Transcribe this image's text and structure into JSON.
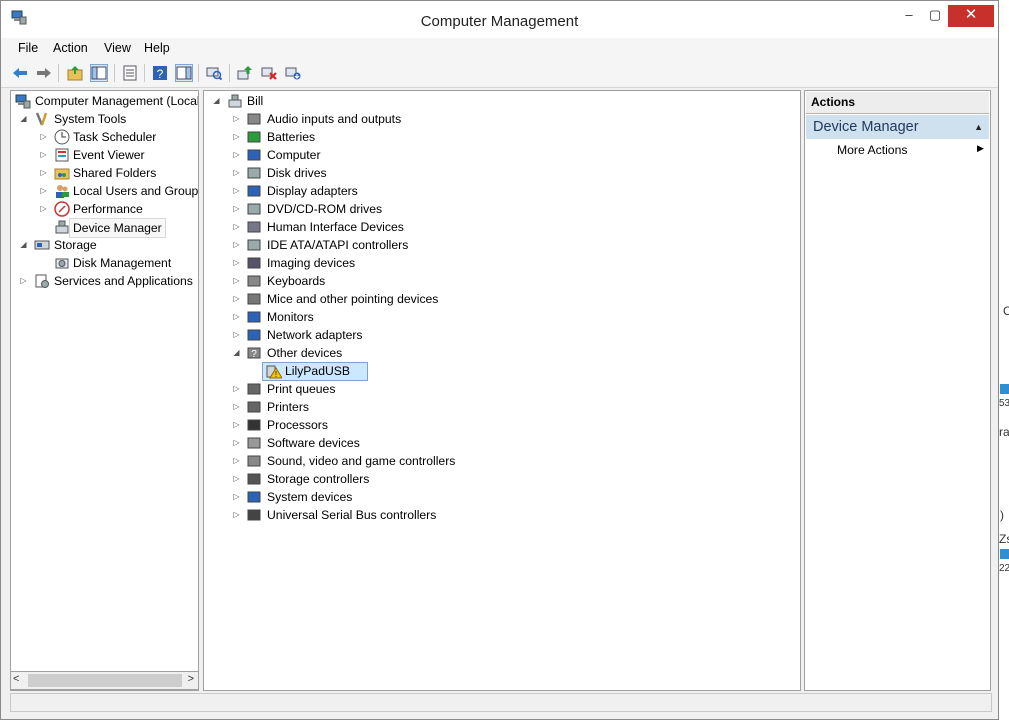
{
  "window": {
    "title": "Computer Management",
    "controls": {
      "minimize": "–",
      "maximize": "▢",
      "close": "✕"
    }
  },
  "menu": [
    "File",
    "Action",
    "View",
    "Help"
  ],
  "left_tree": {
    "root": "Computer Management (Local",
    "system_tools": {
      "label": "System Tools",
      "children": [
        "Task Scheduler",
        "Event Viewer",
        "Shared Folders",
        "Local Users and Groups",
        "Performance",
        "Device Manager"
      ]
    },
    "storage": {
      "label": "Storage",
      "children": [
        "Disk Management"
      ]
    },
    "services": "Services and Applications"
  },
  "device_tree": {
    "root": "Bill",
    "categories": [
      "Audio inputs and outputs",
      "Batteries",
      "Computer",
      "Disk drives",
      "Display adapters",
      "DVD/CD-ROM drives",
      "Human Interface Devices",
      "IDE ATA/ATAPI controllers",
      "Imaging devices",
      "Keyboards",
      "Mice and other pointing devices",
      "Monitors",
      "Network adapters",
      "Other devices",
      "Print queues",
      "Printers",
      "Processors",
      "Software devices",
      "Sound, video and game controllers",
      "Storage controllers",
      "System devices",
      "Universal Serial Bus controllers"
    ],
    "other_devices_child": "LilyPadUSB"
  },
  "actions": {
    "header": "Actions",
    "section": "Device Manager",
    "more": "More Actions"
  },
  "background_fragments": [
    "C",
    "53",
    "ra",
    ")",
    "Zs",
    "22"
  ],
  "colors": {
    "close": "#c7302b",
    "selection": "#cce8ff",
    "actions_section": "#cfe0ef",
    "warning": "#f5c400"
  }
}
